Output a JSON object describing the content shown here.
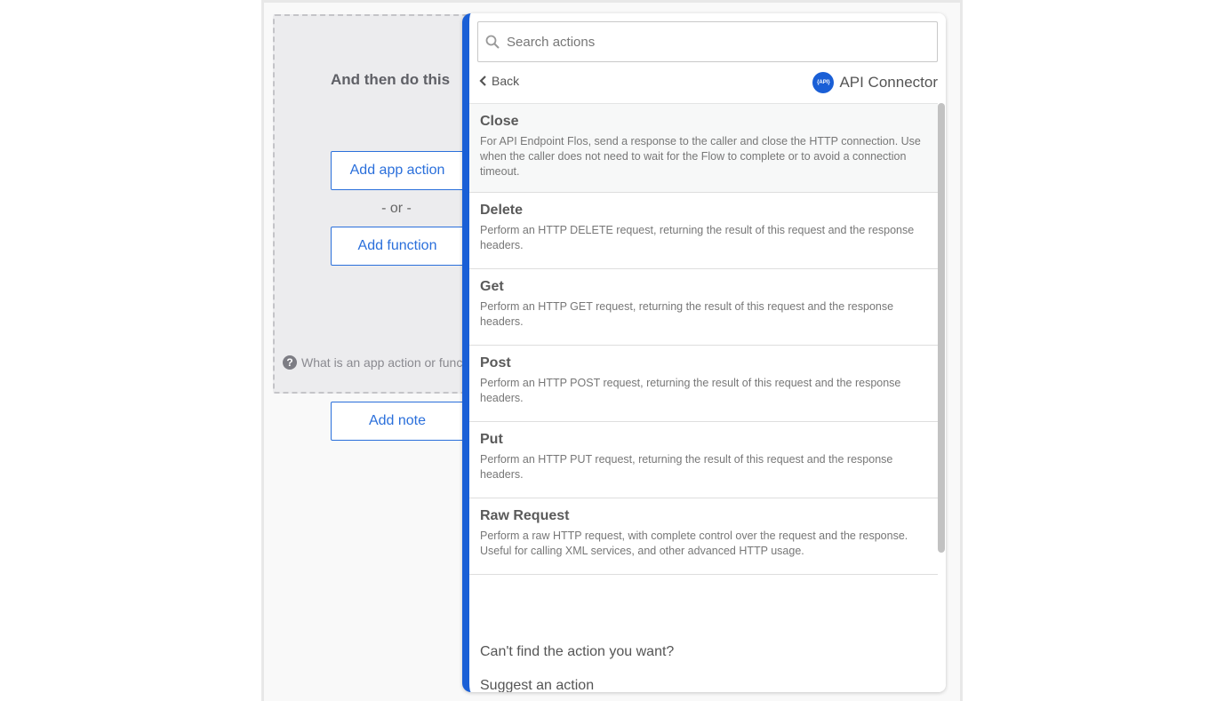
{
  "canvas": {
    "heading": "And then do this",
    "add_app_action": "Add app action",
    "or": "- or -",
    "add_function": "Add function",
    "help": "What is an app action or function?",
    "add_note": "Add note"
  },
  "panel": {
    "search_placeholder": "Search actions",
    "back": "Back",
    "connector": "API Connector",
    "connector_logo": "API",
    "actions": [
      {
        "title": "Close",
        "description": "For API Endpoint Flos, send a response to the caller and close the HTTP connection. Use when the caller does not need to wait for the Flow to complete or to avoid a connection timeout."
      },
      {
        "title": "Delete",
        "description": "Perform an HTTP DELETE request, returning the result of this request and the response headers."
      },
      {
        "title": "Get",
        "description": "Perform an HTTP GET request, returning the result of this request and the response headers."
      },
      {
        "title": "Post",
        "description": "Perform an HTTP POST request, returning the result of this request and the response headers."
      },
      {
        "title": "Put",
        "description": "Perform an HTTP PUT request, returning the result of this request and the response headers."
      },
      {
        "title": "Raw Request",
        "description": "Perform a raw HTTP request, with complete control over the request and the response. Useful for calling XML services, and other advanced HTTP usage."
      }
    ],
    "cant_find": "Can't find the action you want?",
    "suggest": "Suggest an action"
  },
  "colors": {
    "accent": "#1a5fd6",
    "button": "#2a6fdb"
  }
}
